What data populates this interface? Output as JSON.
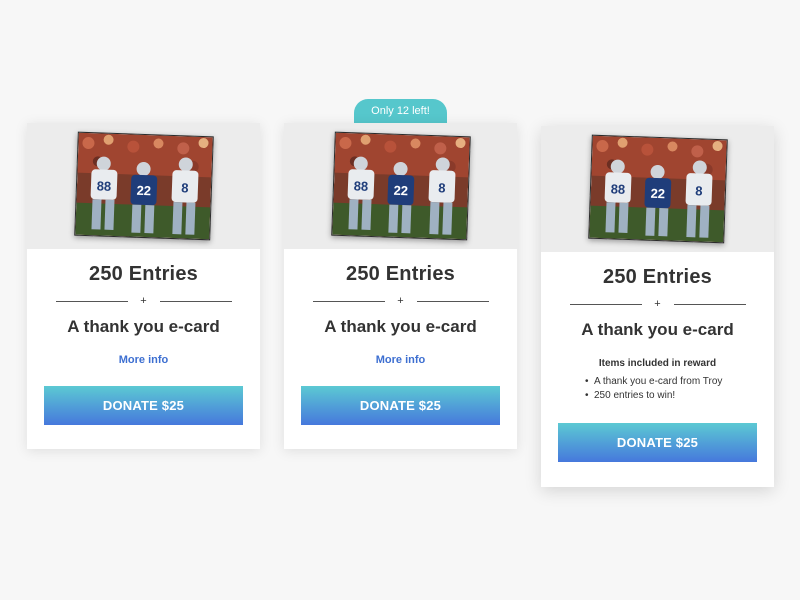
{
  "badge": {
    "text": "Only 12 left!"
  },
  "cards": [
    {
      "entries": "250 Entries",
      "divider_symbol": "+",
      "reward_title": "A thank you e-card",
      "more_info": "More info",
      "donate_label": "DONATE $25"
    },
    {
      "entries": "250 Entries",
      "divider_symbol": "+",
      "reward_title": "A thank you e-card",
      "more_info": "More info",
      "donate_label": "DONATE $25"
    },
    {
      "entries": "250 Entries",
      "divider_symbol": "+",
      "reward_title": "A thank you e-card",
      "items_heading": "Items included in  reward",
      "items": [
        "A thank you e-card from Troy",
        "250 entries to win!"
      ],
      "donate_label": "DONATE $25"
    }
  ],
  "colors": {
    "accent_teal": "#56c7cc",
    "link_blue": "#3d6fd1",
    "button_gradient_top": "#5cc9d3",
    "button_gradient_bottom": "#4678dc"
  }
}
